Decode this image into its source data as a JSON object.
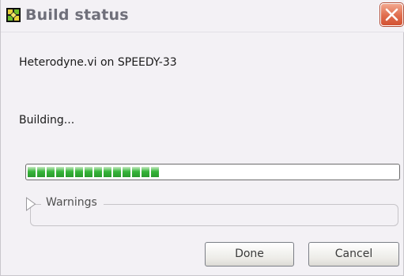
{
  "window": {
    "title": "Build status",
    "close_icon": "close-icon",
    "app_icon": "labview-vi-icon"
  },
  "content": {
    "vi_name": "Heterodyne.vi on SPEEDY-33",
    "status": "Building...",
    "progress": 0.38,
    "warnings_label": "Warnings"
  },
  "buttons": {
    "done": "Done",
    "cancel": "Cancel"
  },
  "colors": {
    "progress_green": "#37b53a",
    "close_red": "#e06d4d"
  }
}
